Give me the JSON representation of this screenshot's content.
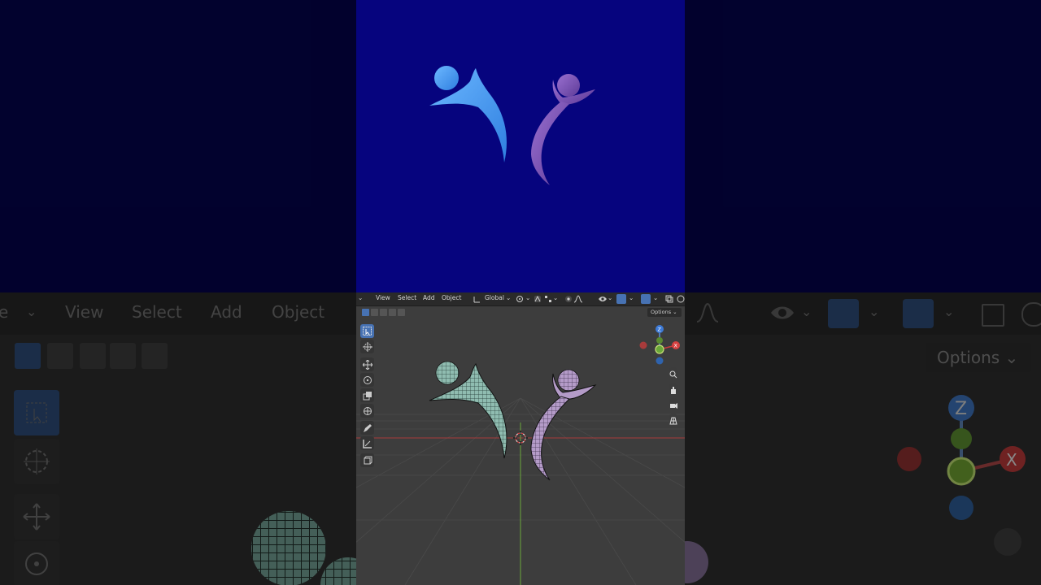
{
  "viewport_header": {
    "mode_label": "",
    "menu": [
      "View",
      "Select",
      "Add",
      "Object"
    ],
    "orientation": "Global",
    "options_label": "Options"
  },
  "gizmo": {
    "z": "Z",
    "y": "Y",
    "x": "X"
  },
  "tools": [
    "select-box",
    "cursor",
    "move",
    "rotate",
    "scale",
    "transform",
    "annotate",
    "measure",
    "add-cube"
  ],
  "colors": {
    "render_bg": "#06047e",
    "figure_left": "#3f9df0",
    "figure_right": "#7a4fb0",
    "viewport_bg": "#3d3d3d",
    "active_tool": "#4772b3",
    "axis_x": "#c83c3c",
    "axis_y": "#6aa83a",
    "axis_z": "#3d7ad6"
  }
}
